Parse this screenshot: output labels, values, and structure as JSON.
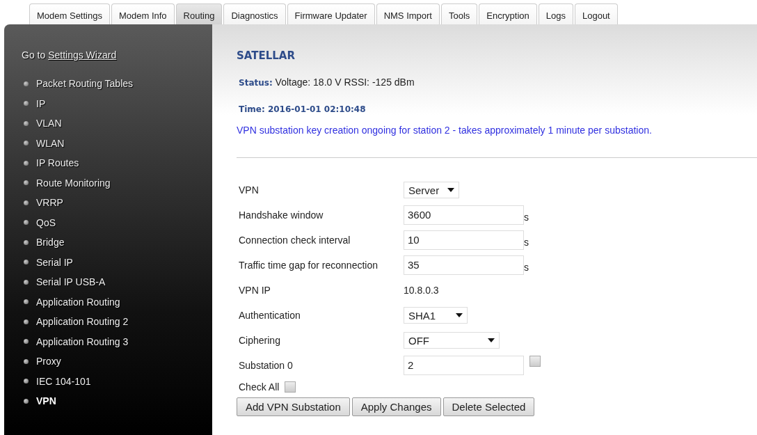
{
  "tabs": [
    {
      "label": "Modem Settings",
      "selected": false
    },
    {
      "label": "Modem Info",
      "selected": false
    },
    {
      "label": "Routing",
      "selected": true
    },
    {
      "label": "Diagnostics",
      "selected": false
    },
    {
      "label": "Firmware Updater",
      "selected": false
    },
    {
      "label": "NMS Import",
      "selected": false
    },
    {
      "label": "Tools",
      "selected": false
    },
    {
      "label": "Encryption",
      "selected": false
    },
    {
      "label": "Logs",
      "selected": false
    },
    {
      "label": "Logout",
      "selected": false
    }
  ],
  "sidebar": {
    "wizard_prefix": "Go to",
    "wizard_link": "Settings Wizard",
    "items": [
      {
        "label": "Packet Routing Tables",
        "selected": false
      },
      {
        "label": "IP",
        "selected": false
      },
      {
        "label": "VLAN",
        "selected": false
      },
      {
        "label": "WLAN",
        "selected": false
      },
      {
        "label": "IP Routes",
        "selected": false
      },
      {
        "label": "Route Monitoring",
        "selected": false
      },
      {
        "label": "VRRP",
        "selected": false
      },
      {
        "label": "QoS",
        "selected": false
      },
      {
        "label": "Bridge",
        "selected": false
      },
      {
        "label": "Serial IP",
        "selected": false
      },
      {
        "label": "Serial IP USB-A",
        "selected": false
      },
      {
        "label": "Application Routing",
        "selected": false
      },
      {
        "label": "Application Routing 2",
        "selected": false
      },
      {
        "label": "Application Routing 3",
        "selected": false
      },
      {
        "label": "Proxy",
        "selected": false
      },
      {
        "label": "IEC 104-101",
        "selected": false
      },
      {
        "label": "VPN",
        "selected": true
      }
    ]
  },
  "main": {
    "title": "SATELLAR",
    "status_label": "Status:",
    "status_value": "Voltage: 18.0 V RSSI: -125 dBm",
    "time": "Time: 2016-01-01 02:10:48",
    "notice": "VPN substation key creation ongoing for station 2 - takes approximately 1 minute per substation.",
    "form": [
      {
        "kind": "select",
        "label": "VPN",
        "value": "Server"
      },
      {
        "kind": "text",
        "label": "Handshake window",
        "value": "3600",
        "unit": "s"
      },
      {
        "kind": "text",
        "label": "Connection check interval",
        "value": "10",
        "unit": "s"
      },
      {
        "kind": "text",
        "label": "Traffic time gap for reconnection",
        "value": "35",
        "unit": "s"
      },
      {
        "kind": "static",
        "label": "VPN IP",
        "value": "10.8.0.3"
      },
      {
        "kind": "select",
        "label": "Authentication",
        "value": "SHA1"
      },
      {
        "kind": "select",
        "label": "Ciphering",
        "value": "OFF"
      },
      {
        "kind": "text_check",
        "label": "Substation 0",
        "value": "2",
        "checked": false
      }
    ],
    "check_all": {
      "label": "Check All",
      "checked": false
    },
    "buttons": [
      "Add VPN Substation",
      "Apply Changes",
      "Delete Selected"
    ]
  }
}
